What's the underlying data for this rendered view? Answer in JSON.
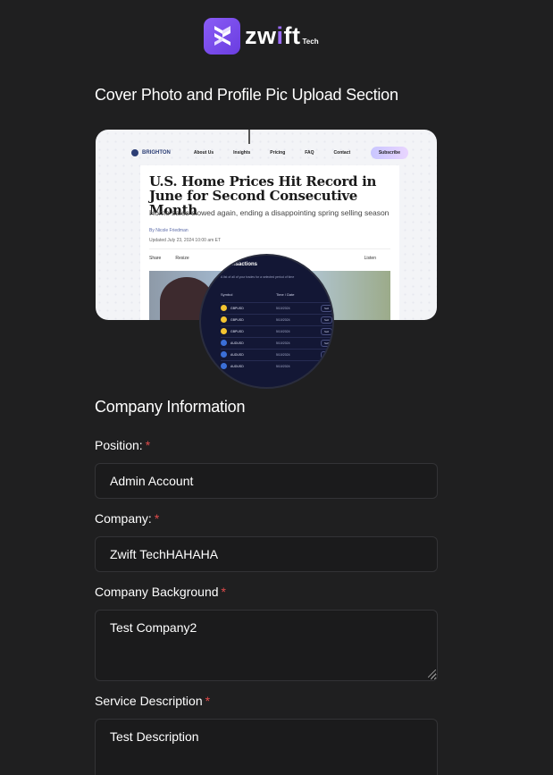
{
  "brand": {
    "word_start": "zw",
    "word_i": "i",
    "word_end": "ft",
    "suffix": "Tech",
    "accent": "#8a5cf6"
  },
  "upload_section": {
    "title": "Cover Photo and Profile Pic Upload Section",
    "cover": {
      "nav_brand": "BRIGHTON",
      "nav_items": [
        "About Us",
        "Insights",
        "Pricing",
        "FAQ",
        "Contact"
      ],
      "nav_cta": "Subscribe",
      "headline": "U.S. Home Prices Hit Record in June for Second Consecutive Month",
      "subhead": "Home sales slowed again, ending a disappointing spring selling season",
      "byline": "By Nicole Friedman",
      "date": "Updated July 23, 2024 10:00 am ET",
      "action_share": "Share",
      "action_resize": "Resize",
      "action_listen": "Listen"
    },
    "profile": {
      "title": "Transactions",
      "subtitle": "A list of all of your trades for a selected period of time",
      "col_symbol": "Symbol",
      "col_time": "Time / Date",
      "rows": [
        {
          "symbol": "GBPUSD",
          "date": "5/10/2024",
          "action": "Sell",
          "color": "#f4c430"
        },
        {
          "symbol": "GBPUSD",
          "date": "5/10/2024",
          "action": "Sell",
          "color": "#f4c430"
        },
        {
          "symbol": "GBPUSD",
          "date": "5/10/2024",
          "action": "Sell",
          "color": "#f4c430"
        },
        {
          "symbol": "AUDUSD",
          "date": "5/10/2024",
          "action": "Sell",
          "color": "#3b6fd8"
        },
        {
          "symbol": "AUDUSD",
          "date": "5/10/2024",
          "action": "Sell",
          "color": "#3b6fd8"
        },
        {
          "symbol": "AUDUSD",
          "date": "5/10/2024",
          "action": "Sell",
          "color": "#3b6fd8"
        }
      ]
    }
  },
  "company_section": {
    "title": "Company Information",
    "position": {
      "label": "Position:",
      "value": "Admin Account"
    },
    "company": {
      "label": "Company:",
      "value": "Zwift TechHAHAHA"
    },
    "background": {
      "label": "Company Background",
      "value": "Test Company2"
    },
    "service": {
      "label": "Service Description",
      "value": "Test Description"
    },
    "required_mark": "*"
  }
}
